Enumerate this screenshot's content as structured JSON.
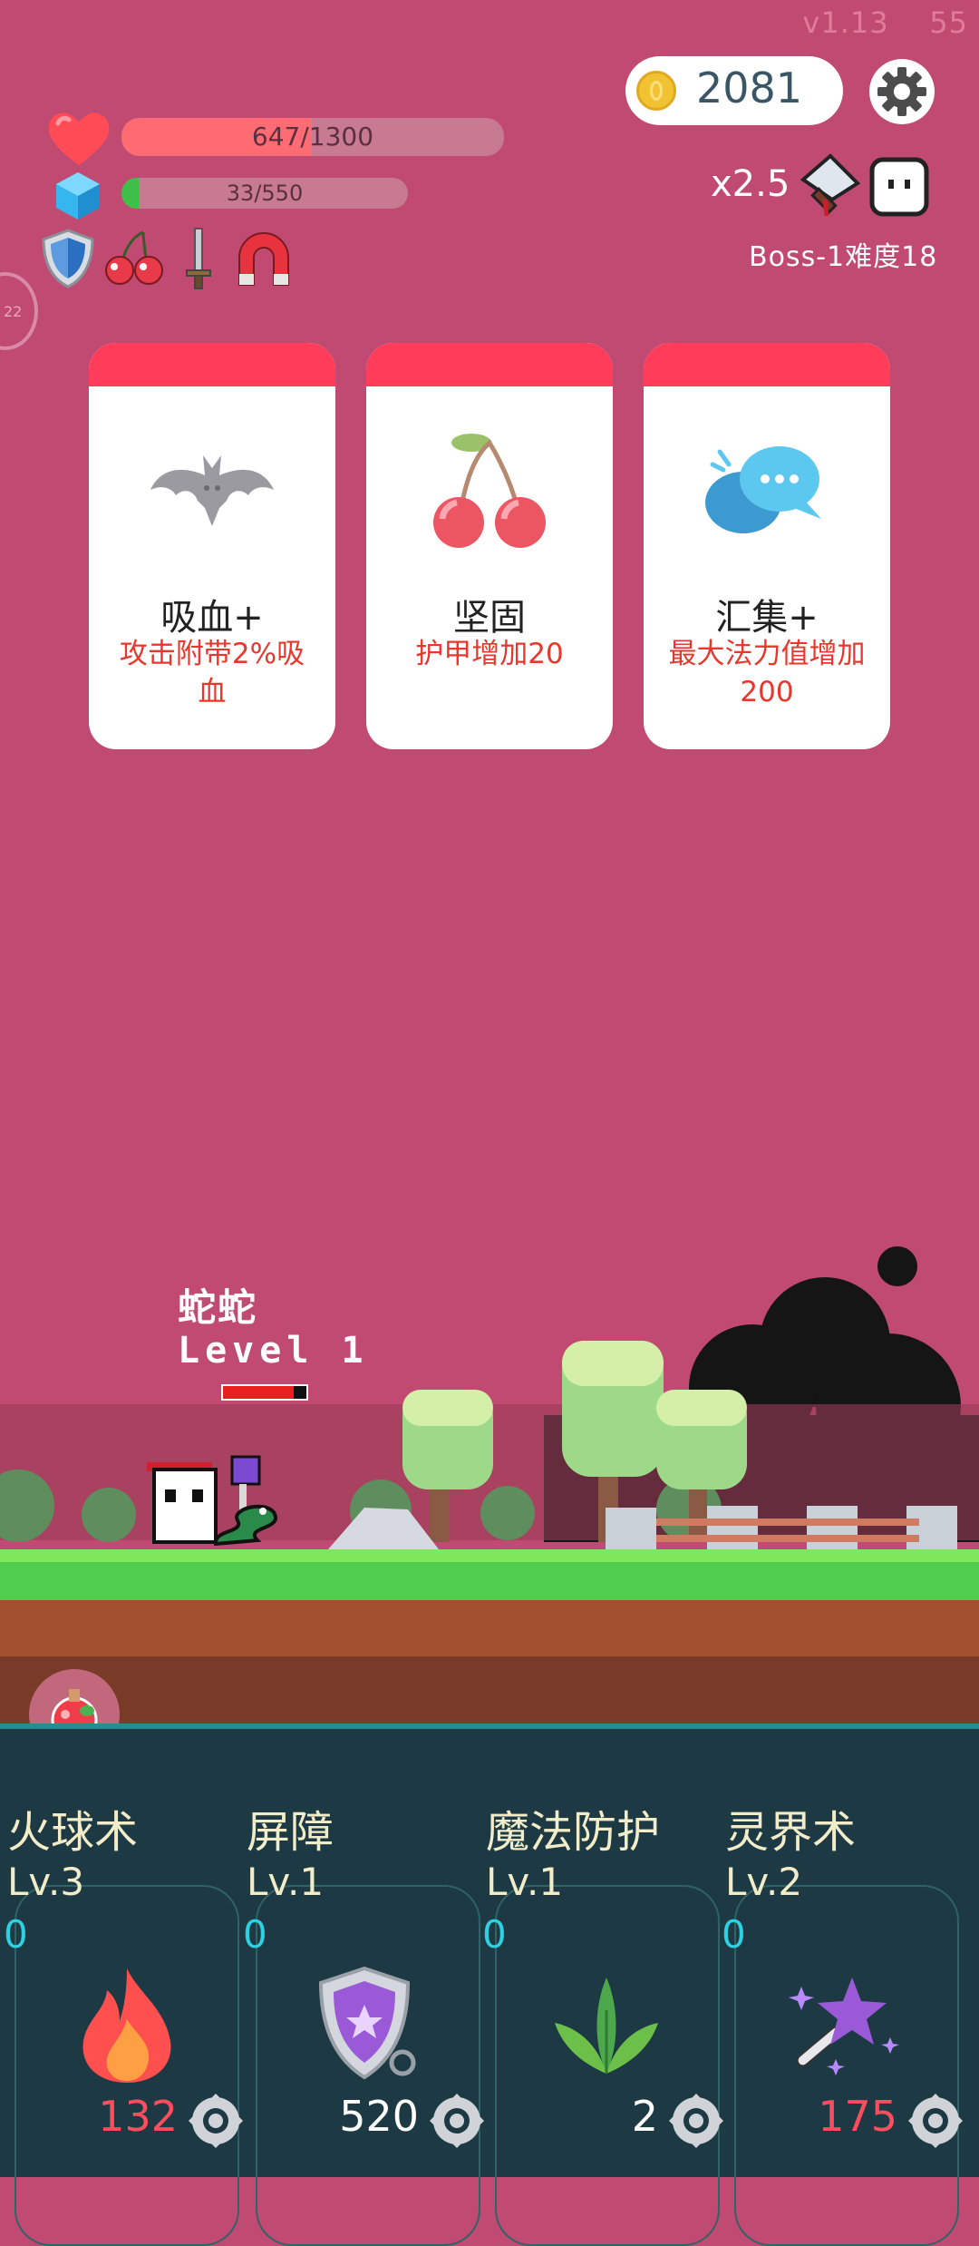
{
  "version": "v1.13",
  "fps": "55",
  "coins": "2081",
  "hp": {
    "text": "647/1300",
    "fraction": 0.498
  },
  "mp": {
    "text": "33/550",
    "fraction": 0.06
  },
  "multiplier": "x2.5",
  "boss_text": "Boss-1难度18",
  "side_tab": "22",
  "buff_icons": [
    "shield-icon",
    "cherry-icon",
    "sword-icon",
    "magnet-icon"
  ],
  "cards": [
    {
      "title": "吸血+",
      "desc": "攻击附带2%吸血",
      "icon": "bat-icon"
    },
    {
      "title": "坚固",
      "desc": "护甲增加20",
      "icon": "cherry-icon"
    },
    {
      "title": "汇集+",
      "desc": "最大法力值增加200",
      "icon": "chat-bubble-icon"
    }
  ],
  "enemy": {
    "name": "蛇蛇",
    "level": "Level 1",
    "hp_fraction": 0.85
  },
  "skills": [
    {
      "name": "火球术",
      "level": "Lv.3",
      "count": "0",
      "cost": "132",
      "cost_color": "#ff4d5e",
      "icon": "fire-icon"
    },
    {
      "name": "屏障",
      "level": "Lv.1",
      "count": "0",
      "cost": "520",
      "cost_color": "#ffffff",
      "icon": "shield-star-icon"
    },
    {
      "name": "魔法防护",
      "level": "Lv.1",
      "count": "0",
      "cost": "2",
      "cost_color": "#ffffff",
      "icon": "leaf-icon"
    },
    {
      "name": "灵界术",
      "level": "Lv.2",
      "count": "0",
      "cost": "175",
      "cost_color": "#ff4d5e",
      "icon": "magic-wand-icon"
    }
  ],
  "colors": {
    "background": "#c04a72",
    "hp_fill": "#ff6b72",
    "mp_fill": "#3fbf4a",
    "card_header": "#ff3d5b",
    "panel": "#1d3a44"
  }
}
